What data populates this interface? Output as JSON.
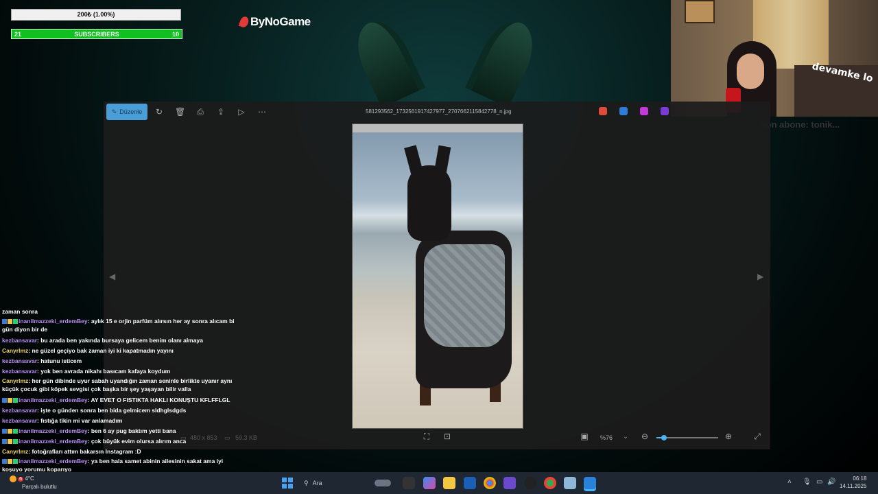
{
  "overlay": {
    "donation_text": "200₺ (1.00%)",
    "subscribers_left": "21",
    "subscribers_label": "SUBSCRIBERS",
    "subscribers_right": "10",
    "brand": "ByNoGame",
    "cam_sign": "devamke lo",
    "cam_overlay_text": "Son abone: tonik..."
  },
  "viewer": {
    "edit_label": "Düzenle",
    "filename": "581293562_1732561917427977_2707662115842778_n.jpg",
    "dimensions": "480 x 853",
    "filesize": "59.3 KB",
    "zoom": "%76",
    "zoom_fraction": 0.12
  },
  "chat": {
    "messages": [
      {
        "user": "",
        "text": "zaman sonra",
        "color": "none"
      },
      {
        "user": "inanilmazzeki_erdemBey",
        "text": ": aylık 15 e orjin parfüm alırsın her ay sonra alıcam bi gün diyon bir de",
        "color": "purple",
        "badges": true
      },
      {
        "user": "kezbansavar",
        "text": ": bu arada ben yakında bursaya gelicem benim olanı almaya",
        "color": "purple"
      },
      {
        "user": "Canyrlmz",
        "text": ": ne güzel geçiyo bak zaman iyi ki kapatmadın yayını",
        "color": "yellow"
      },
      {
        "user": "kezbansavar",
        "text": ": hatunu isticem",
        "color": "purple"
      },
      {
        "user": "kezbansavar",
        "text": ": yok ben avrada nikahı basıcam kafaya koydum",
        "color": "purple"
      },
      {
        "user": "Canyrlmz",
        "text": ": her gün dibinde uyur sabah uyandığın zaman seninle birlikte uyanır aynı küçük çocuk gibi köpek sevgisi çok başka bir şey yaşayan bilir valla",
        "color": "yellow"
      },
      {
        "user": "inanilmazzeki_erdemBey",
        "text": ": AY EVET O FISTIKTA HAKLI KONUŞTU KFLFFLGL",
        "color": "purple",
        "badges": true
      },
      {
        "user": "kezbansavar",
        "text": ": işte o günden sonra ben bida gelmicem sldhglsdgds",
        "color": "purple"
      },
      {
        "user": "kezbansavar",
        "text": ": fıstığa tikin mi var anlamadım",
        "color": "purple"
      },
      {
        "user": "inanilmazzeki_erdemBey",
        "text": ": ben 6 ay pug baktım yetti bana",
        "color": "purple",
        "badges": true
      },
      {
        "user": "inanilmazzeki_erdemBey",
        "text": ": çok büyük evim olursa alırım anca",
        "color": "purple",
        "badges": true
      },
      {
        "user": "Canyrlmz",
        "text": ": fotoğrafları attım bakarsın Instagram :D",
        "color": "yellow"
      },
      {
        "user": "inanilmazzeki_erdemBey",
        "text": ": ya ben hala samet abinin ailesinin sakat ama iyi koşuyo yorumu koparıyo",
        "color": "purple",
        "badges": true
      }
    ]
  },
  "taskbar": {
    "temperature": "4°C",
    "weather": "Parçalı bulutlu",
    "search_placeholder": "Ara",
    "time": "06:18",
    "date": "14.11.2025",
    "notification_count": "6"
  }
}
